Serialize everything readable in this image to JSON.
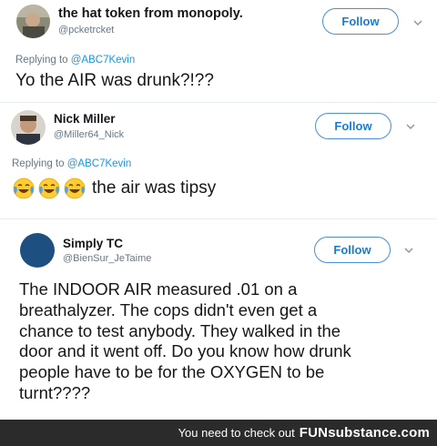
{
  "tweets": [
    {
      "name": "the hat token from monopoly.",
      "handle": "@pcketrcket",
      "follow_label": "Follow",
      "replying_prefix": "Replying to",
      "replying_to": "@ABC7Kevin",
      "text": "Yo the AIR was drunk?!??"
    },
    {
      "name": "Nick Miller",
      "handle": "@Miller64_Nick",
      "follow_label": "Follow",
      "replying_prefix": "Replying to",
      "replying_to": "@ABC7Kevin",
      "emojis": [
        "face-with-tears-of-joy",
        "face-with-tears-of-joy",
        "face-with-tears-of-joy"
      ],
      "text": "the air was tipsy"
    },
    {
      "name": "Simply TC",
      "handle": "@BienSur_JeTaime",
      "follow_label": "Follow",
      "avatar_color": "#1d4f80",
      "lines": [
        "The INDOOR AIR measured .01 on a",
        "breathalyzer. The cops didn't even get a",
        "chance to test anybody. They walked in the",
        "door and it went off. Do you know how drunk",
        "people have to be for the OXYGEN to be",
        "turnt????"
      ]
    }
  ],
  "footer": {
    "text": "You need to check out",
    "brand": "FUNsubstance.com"
  },
  "colors": {
    "link": "#1b95e0",
    "follow_border": "#4a90d9",
    "footer_bg": "#2b2b2b"
  }
}
